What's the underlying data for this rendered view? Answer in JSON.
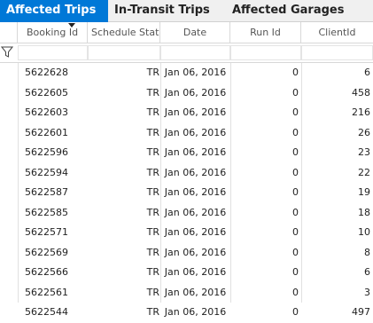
{
  "tabs": [
    {
      "label": "Affected Trips",
      "active": true
    },
    {
      "label": "In-Transit Trips",
      "active": false
    },
    {
      "label": "Affected Garages",
      "active": false
    }
  ],
  "columns": [
    "Booking Id",
    "Schedule Status",
    "Date",
    "Run Id",
    "ClientId"
  ],
  "sort": {
    "column": "Booking Id",
    "direction": "descending"
  },
  "rows": [
    {
      "booking_id": "5622628",
      "status": "TR",
      "date": "Jan 06, 2016",
      "run_id": "0",
      "client_id": "6"
    },
    {
      "booking_id": "5622605",
      "status": "TR",
      "date": "Jan 06, 2016",
      "run_id": "0",
      "client_id": "458"
    },
    {
      "booking_id": "5622603",
      "status": "TR",
      "date": "Jan 06, 2016",
      "run_id": "0",
      "client_id": "216"
    },
    {
      "booking_id": "5622601",
      "status": "TR",
      "date": "Jan 06, 2016",
      "run_id": "0",
      "client_id": "26"
    },
    {
      "booking_id": "5622596",
      "status": "TR",
      "date": "Jan 06, 2016",
      "run_id": "0",
      "client_id": "23"
    },
    {
      "booking_id": "5622594",
      "status": "TR",
      "date": "Jan 06, 2016",
      "run_id": "0",
      "client_id": "22"
    },
    {
      "booking_id": "5622587",
      "status": "TR",
      "date": "Jan 06, 2016",
      "run_id": "0",
      "client_id": "19"
    },
    {
      "booking_id": "5622585",
      "status": "TR",
      "date": "Jan 06, 2016",
      "run_id": "0",
      "client_id": "18"
    },
    {
      "booking_id": "5622571",
      "status": "TR",
      "date": "Jan 06, 2016",
      "run_id": "0",
      "client_id": "10"
    },
    {
      "booking_id": "5622569",
      "status": "TR",
      "date": "Jan 06, 2016",
      "run_id": "0",
      "client_id": "8"
    },
    {
      "booking_id": "5622566",
      "status": "TR",
      "date": "Jan 06, 2016",
      "run_id": "0",
      "client_id": "6"
    },
    {
      "booking_id": "5622561",
      "status": "TR",
      "date": "Jan 06, 2016",
      "run_id": "0",
      "client_id": "3"
    },
    {
      "booking_id": "5622544",
      "status": "TR",
      "date": "Jan 06, 2016",
      "run_id": "0",
      "client_id": "497"
    }
  ],
  "colors": {
    "accent": "#0078d7",
    "tab_bg": "#f0f0f0",
    "grid_line": "#e1e1e1"
  }
}
